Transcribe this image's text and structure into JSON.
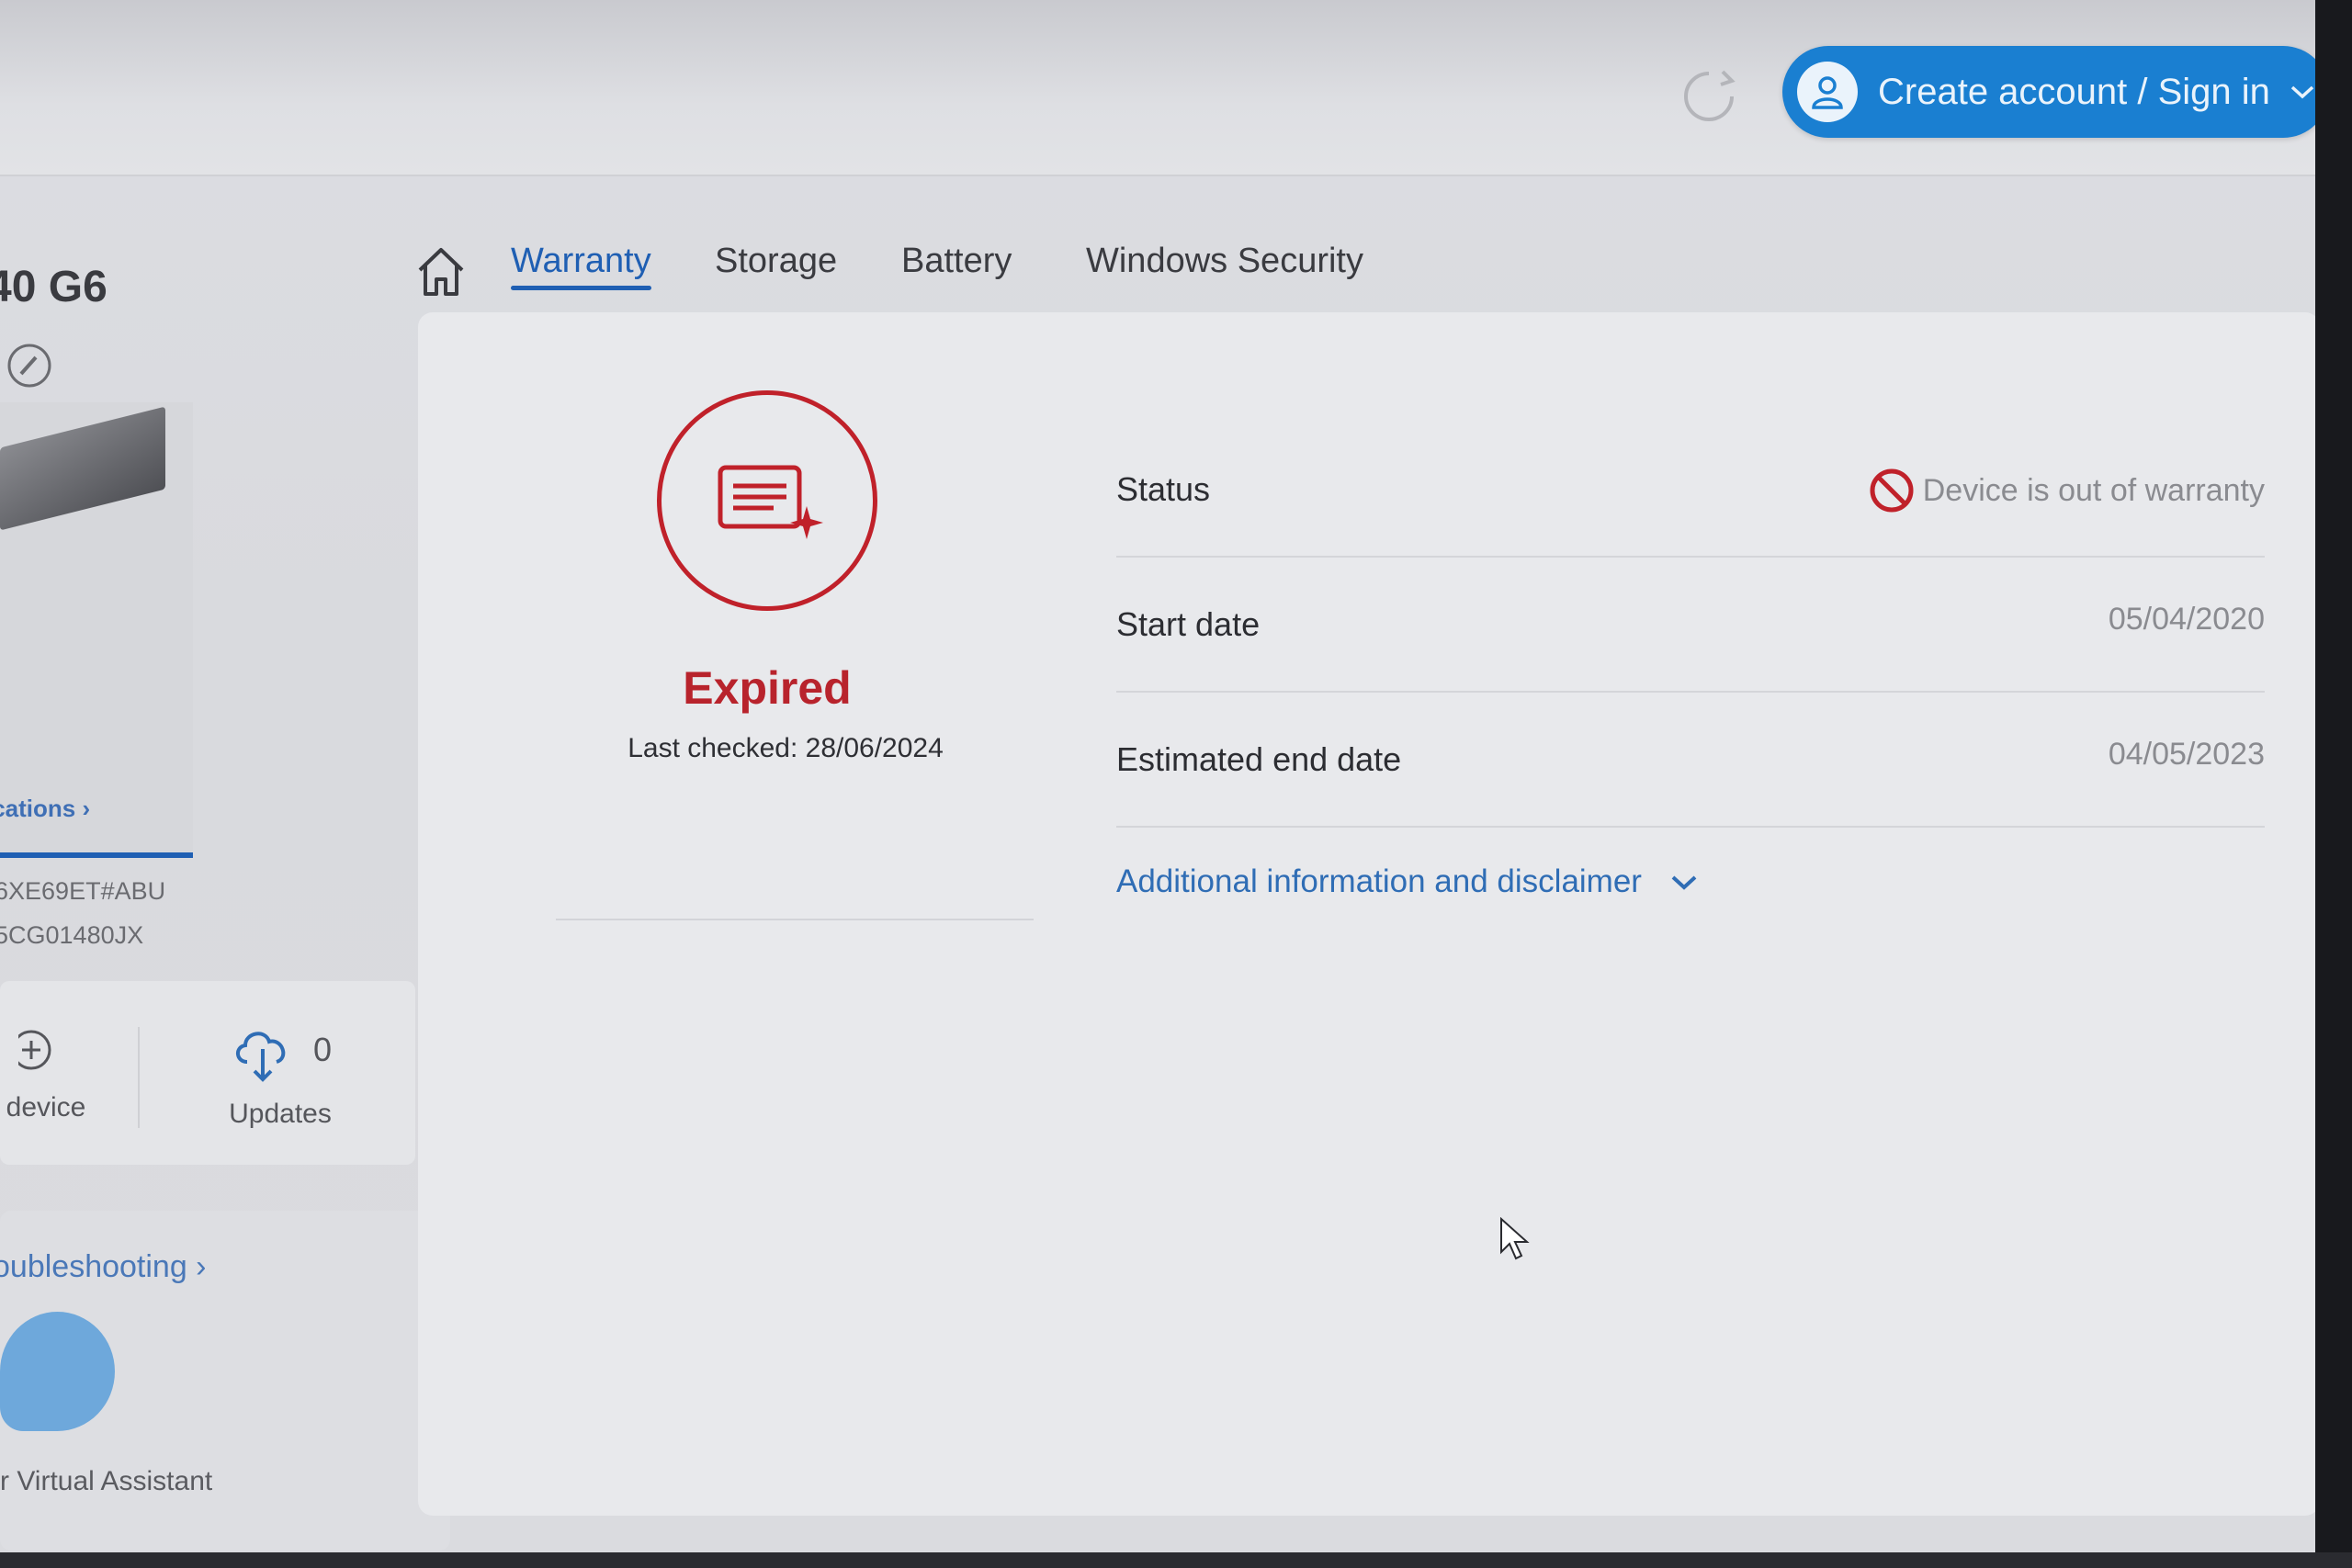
{
  "header": {
    "refresh_icon": "refresh-icon",
    "signin_label": "Create account / Sign in",
    "accent_color": "#1a7fd1"
  },
  "sidebar": {
    "device_name": "40 G6",
    "specs_link": "ications ›",
    "product_number": "6XE69ET#ABU",
    "serial_number": "5CG01480JX",
    "add_device_label": "device",
    "updates_label": "Updates",
    "updates_count": "0",
    "troubleshooting_link": "oubleshooting ›",
    "virtual_assistant_label": "r Virtual Assistant"
  },
  "tabs": [
    {
      "label": "Warranty",
      "active": true
    },
    {
      "label": "Storage",
      "active": false
    },
    {
      "label": "Battery",
      "active": false
    },
    {
      "label": "Windows Security",
      "active": false
    }
  ],
  "warranty": {
    "state": "Expired",
    "last_checked": "Last checked: 28/06/2024",
    "state_color": "#b8232c",
    "rows": [
      {
        "key": "Status",
        "value": "Device is out of warranty"
      },
      {
        "key": "Start date",
        "value": "05/04/2020"
      },
      {
        "key": "Estimated end date",
        "value": "04/05/2023"
      }
    ],
    "disclaimer_link": "Additional information and disclaimer"
  }
}
